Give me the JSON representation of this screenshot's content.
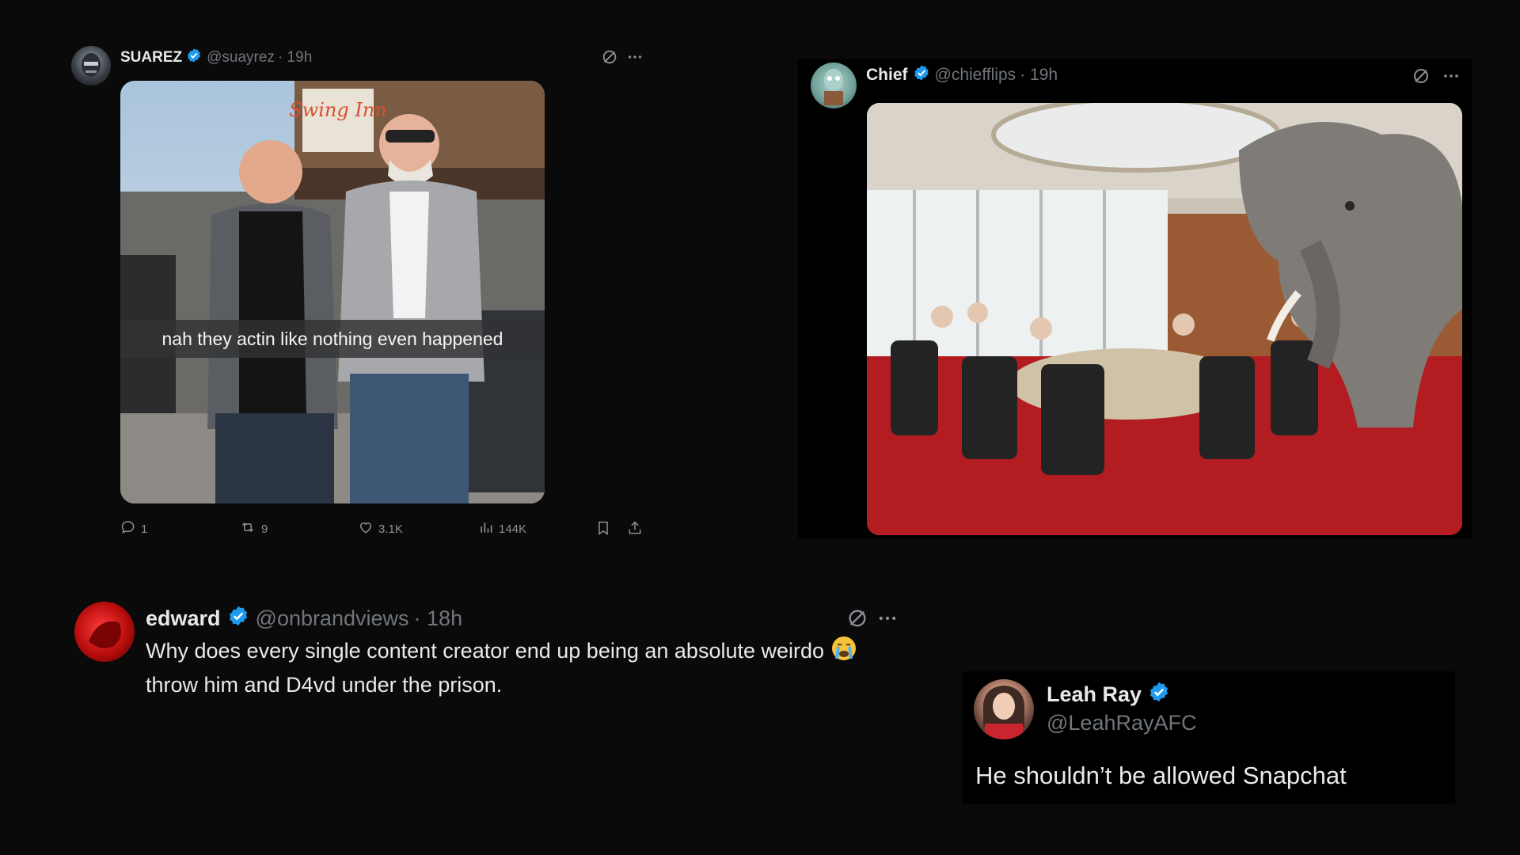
{
  "tweets": [
    {
      "name": "SUAREZ",
      "handle": "@suayrez",
      "time": "· 19h",
      "image_caption": "nah they actin like nothing even happened",
      "image_sign_text": "Swing Inn",
      "stats": {
        "replies": "1",
        "reposts": "9",
        "likes": "3.1K",
        "views": "144K"
      }
    },
    {
      "name": "Chief",
      "handle": "@chiefflips",
      "time": "· 19h"
    },
    {
      "name": "edward",
      "handle": "@onbrandviews",
      "time": "· 18h",
      "text_line1": "Why does every single content creator end up being an absolute weirdo",
      "text_line2": "throw him and D4vd under the prison.",
      "emoji": "😭"
    },
    {
      "name": "Leah Ray",
      "handle": "@LeahRayAFC",
      "text": "He shouldn’t be allowed Snapchat"
    }
  ],
  "colors": {
    "background": "#09090a",
    "text": "#e7e9ea",
    "muted": "#71767b",
    "verified": "#1d9bf0"
  },
  "icons": [
    "grok-icon",
    "more-icon",
    "reply-icon",
    "repost-icon",
    "like-icon",
    "views-icon",
    "bookmark-icon",
    "share-icon",
    "verified-badge-icon"
  ]
}
